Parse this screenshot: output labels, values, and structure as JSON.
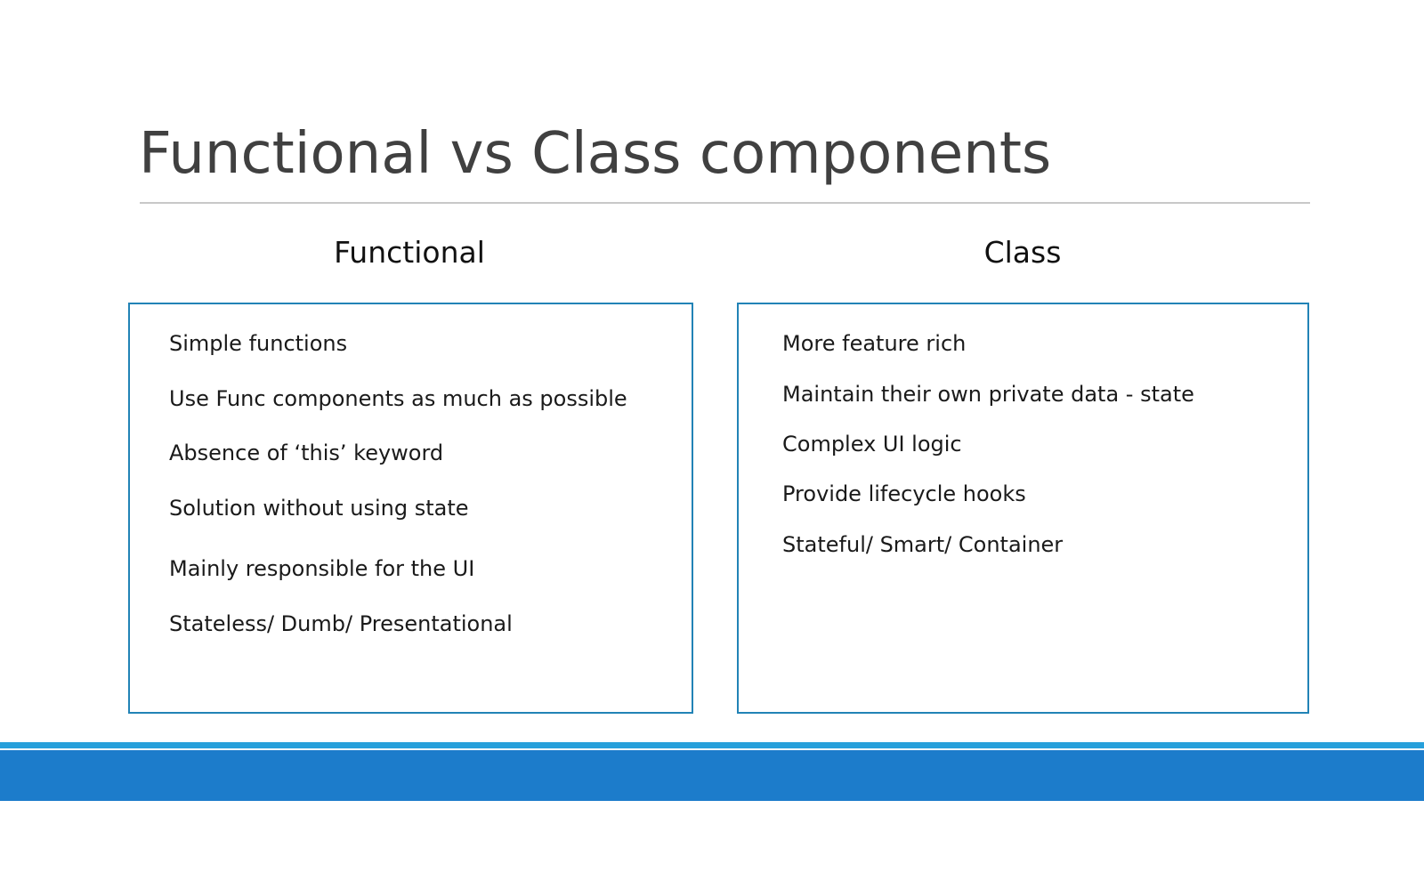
{
  "slide": {
    "title": "Functional vs Class components"
  },
  "columns": {
    "functional": {
      "heading": "Functional",
      "items": [
        "Simple functions",
        "Use Func components as much as possible",
        "Absence of ‘this’ keyword",
        "Solution without using state",
        "Mainly responsible for the UI",
        "Stateless/ Dumb/ Presentational"
      ]
    },
    "class": {
      "heading": "Class",
      "items": [
        "More feature rich",
        "Maintain their own private data - state",
        "Complex UI logic",
        "Provide lifecycle hooks",
        "Stateful/ Smart/ Container"
      ]
    }
  },
  "colors": {
    "box_border": "#2283b6",
    "footer_accent": "#27a0db",
    "footer_bar": "#1c7ccb",
    "title_text": "#404040"
  }
}
